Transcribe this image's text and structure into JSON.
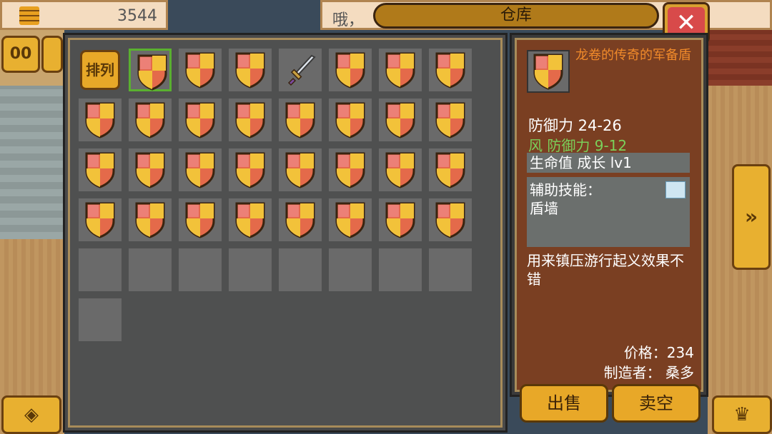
{
  "header": {
    "gold": "3544",
    "message_preview": "哦，",
    "title": "仓库"
  },
  "side_buttons": {
    "left_top": "00",
    "right_arrow": "»",
    "left_bottom": "◈",
    "right_bottom": "♛"
  },
  "inventory": {
    "sort_label": "排列",
    "rows": [
      [
        "sort",
        "shield-sel",
        "shield",
        "shield",
        "sword",
        "shield",
        "shield",
        "shield"
      ],
      [
        "shield",
        "shield",
        "shield",
        "shield",
        "shield",
        "shield",
        "shield",
        "shield"
      ],
      [
        "shield",
        "shield",
        "shield",
        "shield",
        "shield",
        "shield",
        "shield",
        "shield"
      ],
      [
        "shield",
        "shield",
        "shield",
        "shield",
        "shield",
        "shield",
        "shield",
        "shield"
      ],
      [
        "empty",
        "empty",
        "empty",
        "empty",
        "empty",
        "empty",
        "empty",
        "empty"
      ],
      [
        "empty"
      ]
    ]
  },
  "detail": {
    "name": "龙卷的传奇的军备盾",
    "defense": "防御力 24-26",
    "wind_defense": "风 防御力 9-12",
    "growth": "生命值 成长 lv1",
    "skill_label": "辅助技能：",
    "skill_name": "盾墙",
    "description": "用来镇压游行起义效果不错",
    "price": "价格：234",
    "maker": "制造者： 桑多"
  },
  "actions": {
    "sell": "出售",
    "sell_all": "卖空"
  },
  "colors": {
    "accent": "#e8a828",
    "panel_bg": "#4f5050",
    "detail_bg": "#7a3f22",
    "name_color": "#f08a2a",
    "green_stat": "#7ad05a",
    "close_red": "#d84a4a"
  }
}
